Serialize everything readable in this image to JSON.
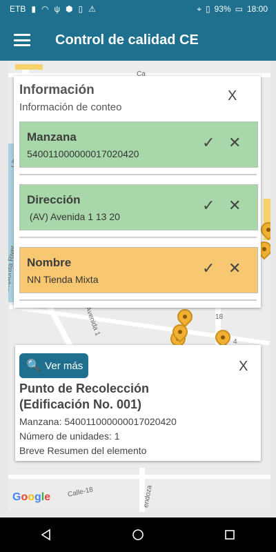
{
  "statusbar": {
    "carrier": "ETB",
    "battery": "93%",
    "time": "18:00"
  },
  "appbar": {
    "title": "Control de calidad CE"
  },
  "map": {
    "street_labels": [
      "Ca",
      "Libe",
      "Pamplonita River",
      "Avenida 1",
      "Calle-18",
      "endoza",
      "4",
      "18"
    ],
    "brand": "Google"
  },
  "info_panel": {
    "title": "Información",
    "subtitle": "Información de conteo",
    "close_label": "X",
    "rows": [
      {
        "label": "Manzana",
        "value": "540011000000017020420",
        "status": "green"
      },
      {
        "label": "Dirección",
        "value": " (AV) Avenida 1 13 20",
        "status": "green"
      },
      {
        "label": "Nombre",
        "value": "NN Tienda Mixta",
        "status": "orange"
      }
    ]
  },
  "point_card": {
    "button_label": "Ver más",
    "close_label": "X",
    "title_line1": "Punto de Recolección",
    "title_line2": "(Edificación No. 001)",
    "manzana_line": "Manzana: 540011000000017020420",
    "units_line": "Número de unidades: 1",
    "summary_line": "Breve Resumen del elemento"
  },
  "colors": {
    "primary": "#1f6f8f",
    "green_row": "#a8d8a9",
    "orange_row": "#f8c771"
  },
  "icons": {
    "check": "✓",
    "cross": "✕"
  }
}
